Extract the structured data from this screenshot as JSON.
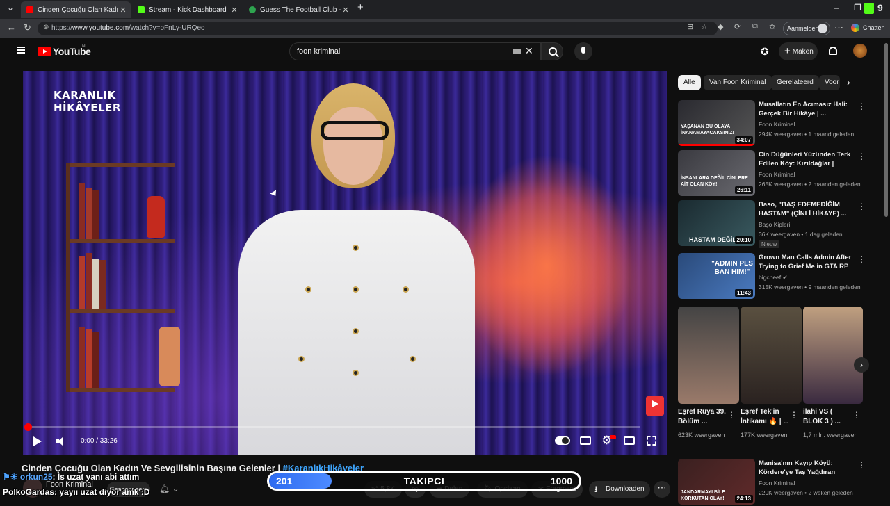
{
  "browser": {
    "tabs": [
      {
        "title": "Cinden Çocuğu Olan Kadın Ve Sevgilisinin Başına Gelenler",
        "active": true,
        "favicon_color": "#ff0000"
      },
      {
        "title": "Stream - Kick Dashboard",
        "active": false,
        "favicon_color": "#53fc18"
      },
      {
        "title": "Guess The Football Club - Football Quiz",
        "active": false,
        "favicon_color": "#2ea44f"
      }
    ],
    "new_tab": "+",
    "url_prefix": "https://",
    "url_domain": "www.youtube.com",
    "url_path": "/watch?v=oFnLy-URQeo",
    "signin_label": "Aanmelden",
    "chat_label": "Chatten"
  },
  "youtube": {
    "logo_text": "YouTube",
    "country_code": "NL",
    "search_value": "foon kriminal",
    "create_label": "Maken"
  },
  "player": {
    "brand_logo": "KARANLIK\nHİKÂYELER",
    "time_display": "0:00 / 33:26",
    "progress_fraction": 0.0
  },
  "video": {
    "title": "Cinden Çocuğu Olan Kadın Ve Sevgilisinin Başına Gelenler | ",
    "hashtag": "#KaranlıkHikâyeler",
    "channel": "Foon Kriminal",
    "subscriber_text": "...",
    "subscribe_label": "Geabonneerd",
    "like_count": "5,8K",
    "share_label": "Delen",
    "save_label": "Opslaan",
    "clip_label": "Fragment",
    "download_label": "Downloaden"
  },
  "overlay": {
    "chat": [
      {
        "user": "orkun25",
        "message": ": Is uzat yanı abi attım",
        "user_color": "#5aa8ff"
      },
      {
        "user": "PolkoGardas",
        "message": ": yayıı uzat diyor amk :D",
        "user_color": "#ffffff"
      }
    ],
    "follower_goal": {
      "current": "201",
      "label": "TAKIPCI",
      "goal": "1000",
      "fraction": 0.201
    }
  },
  "sidebar": {
    "chips": [
      "Alle",
      "Van Foon Kriminal",
      "Gerelateerd",
      "Voor"
    ],
    "recommendations": [
      {
        "title": "Musallatın En Acımasız Hali: Gerçek Bir Hikâye | ...",
        "channel": "Foon Kriminal",
        "meta": "294K weergaven • 1 maand geleden",
        "duration": "34:07",
        "badge": "",
        "thumb_text": "YAŞANAN BU OLAYA İNANAMAYACAKSINIZ!"
      },
      {
        "title": "Cin Düğünleri Yüzünden Terk Edilen Köy: Kızıldağlar | Karanl...",
        "channel": "Foon Kriminal",
        "meta": "265K weergaven • 2 maanden geleden",
        "duration": "26:11",
        "badge": "",
        "thumb_text": "İNSANLARA DEĞİL CİNLERE AİT OLAN KÖY!"
      },
      {
        "title": "Baso, \"BAŞ EDEMEDİĞİM HASTAM\" (ÇİNLİ HİKAYE) ...",
        "channel": "Başo Kipleri",
        "meta": "36K weergaven • 1 dag geleden",
        "duration": "20:10",
        "badge": "Nieuw",
        "thumb_text": "HASTAM DEĞİL"
      },
      {
        "title": "Grown Man Calls Admin After Trying to Grief Me in GTA RP",
        "channel": "bigcheef",
        "meta": "315K weergaven • 9 maanden geleden",
        "duration": "11:43",
        "badge": "",
        "thumb_text": "\"ADMIN PLS BAN HIM!\""
      },
      {
        "title": "Manisa'nın Kayıp Köyü: Kördere'ye Taş Yağdıran Fatm...",
        "channel": "Foon Kriminal",
        "meta": "229K weergaven • 2 weken geleden",
        "duration": "24:13",
        "badge": "",
        "thumb_text": "JANDARMAYI BİLE KORKUTAN OLAY!"
      }
    ],
    "shorts": [
      {
        "title": "Eşref Rüya 39. Bölüm ...",
        "views": "623K weergaven"
      },
      {
        "title": "Eşref Tek'in İntikamı 🔥 | ...",
        "views": "177K weergaven"
      },
      {
        "title": "ilahi VS ( BLOK 3 ) ...",
        "views": "1,7 mln. weergaven"
      }
    ]
  }
}
